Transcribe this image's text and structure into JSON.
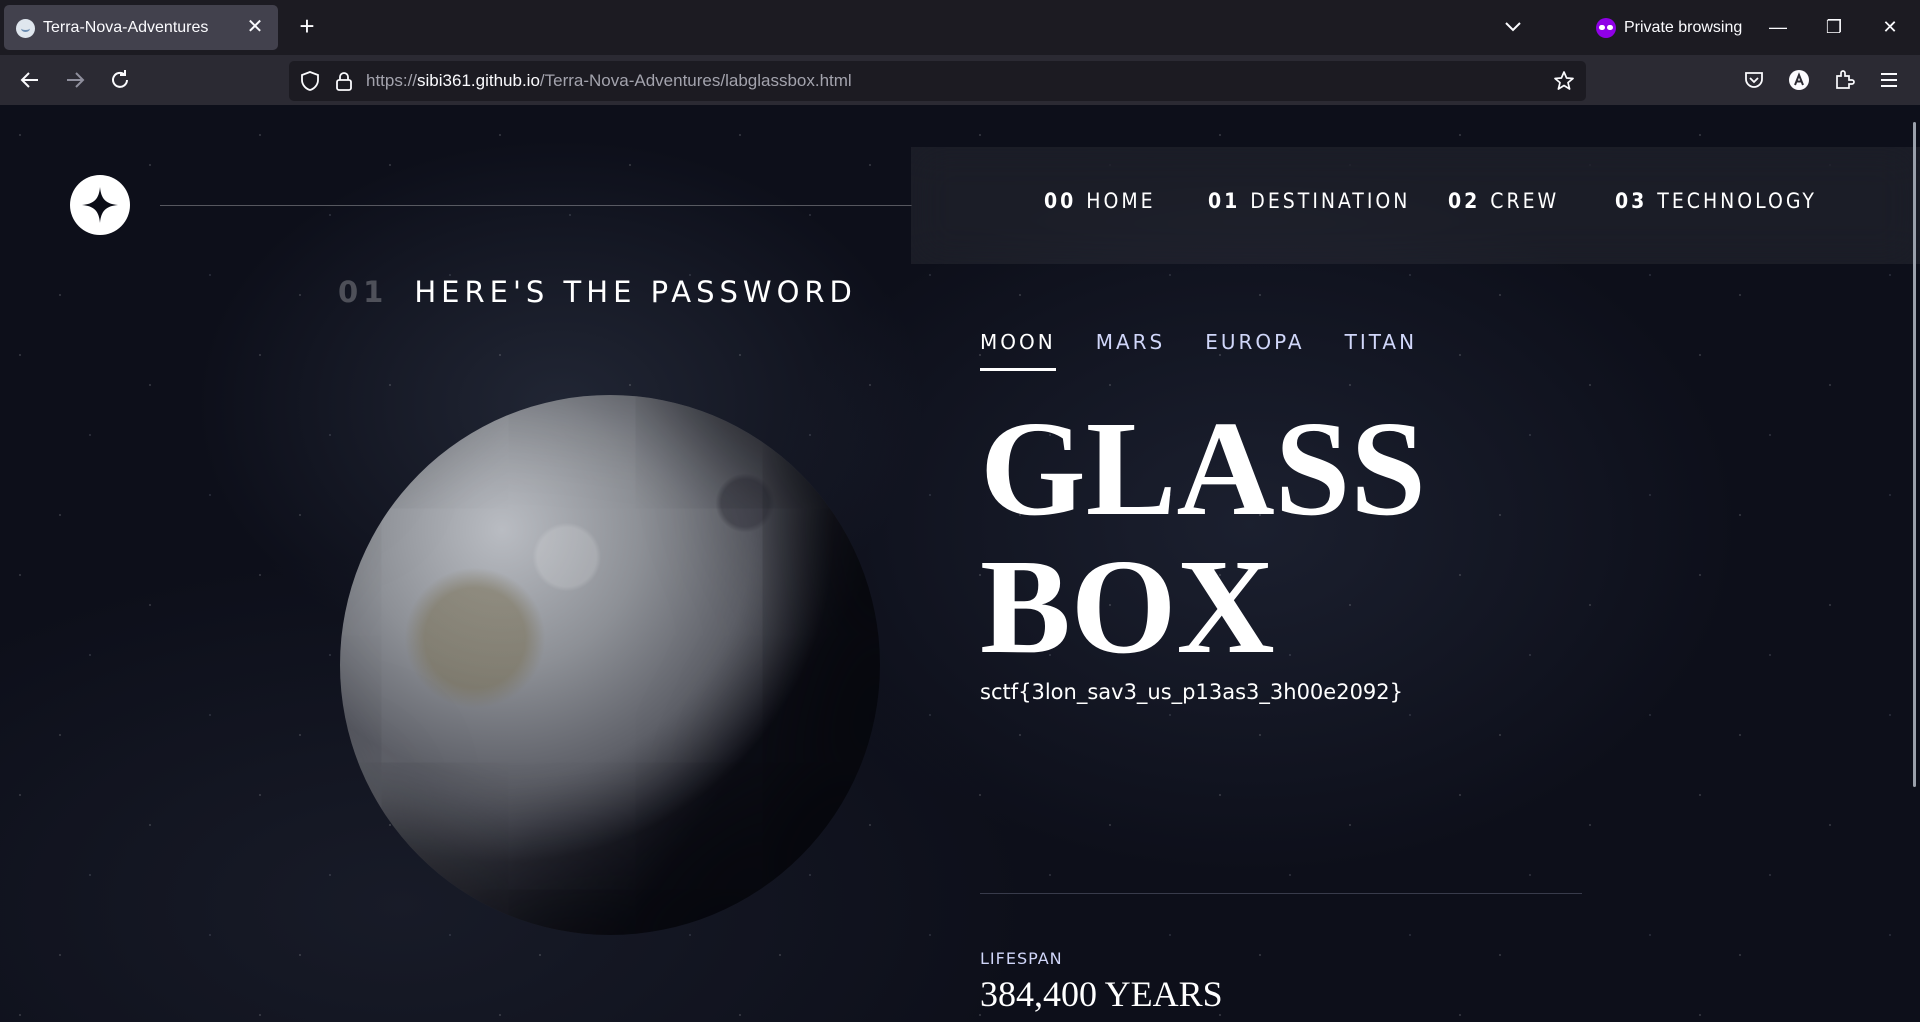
{
  "browser": {
    "tab_title": "Terra-Nova-Adventures",
    "tab_close": "✕",
    "new_tab": "+",
    "private_label": "Private browsing",
    "url_prefix": "https://",
    "url_host": "sibi361.github.io",
    "url_path": "/Terra-Nova-Adventures/labglassbox.html",
    "window_minimize": "—",
    "window_restore": "❐",
    "window_close": "✕"
  },
  "site": {
    "nav": [
      {
        "num": "00",
        "label": "HOME"
      },
      {
        "num": "01",
        "label": "DESTINATION"
      },
      {
        "num": "02",
        "label": "CREW"
      },
      {
        "num": "03",
        "label": "TECHNOLOGY"
      }
    ],
    "eyebrow": {
      "num": "01",
      "text": "HERE'S THE PASSWORD"
    },
    "tabs": [
      "MOON",
      "MARS",
      "EUROPA",
      "TITAN"
    ],
    "active_tab": "MOON",
    "title_line1": "GLASS",
    "title_line2": "BOX",
    "flag": "sctf{3lon_sav3_us_p13as3_3h00e2092}",
    "stat_label": "LIFESPAN",
    "stat_value": "384,400 YEARS"
  },
  "colors": {
    "background": "#0b0d17",
    "accent_text": "#d0d6f9",
    "chrome_dark": "#1c1b22",
    "chrome_tab": "#42414d",
    "private_purple": "#8f00e6"
  }
}
